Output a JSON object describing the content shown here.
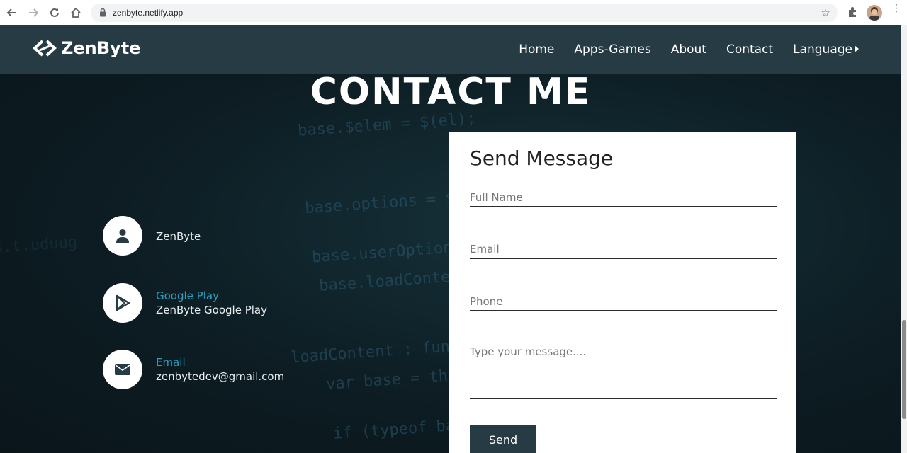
{
  "browser": {
    "url": "zenbyte.netlify.app"
  },
  "header": {
    "logo_text": "ZenByte",
    "nav": [
      "Home",
      "Apps-Games",
      "About",
      "Contact",
      "Language"
    ]
  },
  "main": {
    "title": "CONTACT ME",
    "contacts": [
      {
        "label": "",
        "value": "ZenByte",
        "icon": "person-icon"
      },
      {
        "label": "Google Play",
        "value": "ZenByte Google Play",
        "icon": "play-store-icon"
      },
      {
        "label": "Email",
        "value": "zenbytedev@gmail.com",
        "icon": "envelope-icon"
      }
    ],
    "form": {
      "title": "Send Message",
      "name_placeholder": "Full Name",
      "email_placeholder": "Email",
      "phone_placeholder": "Phone",
      "message_placeholder": "Type your message....",
      "send_label": "Send"
    }
  },
  "colors": {
    "header_bg": "#273b44",
    "accent": "#2aa1c0",
    "button_bg": "#273b44"
  }
}
